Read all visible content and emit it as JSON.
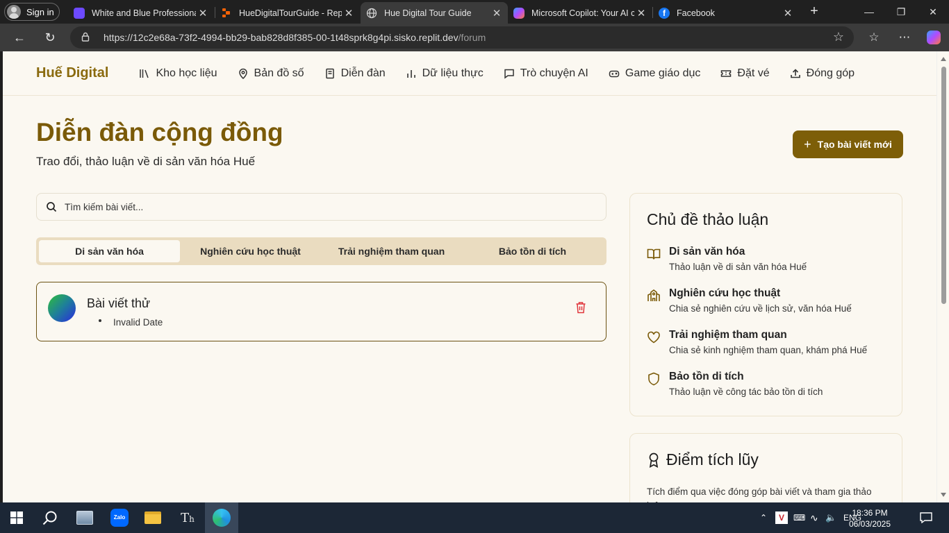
{
  "browser": {
    "signin_label": "Sign in",
    "tabs": [
      {
        "title": "White and Blue Professional",
        "favicon_color": "#6d4aff"
      },
      {
        "title": "HueDigitalTourGuide - Repli",
        "favicon_color": "#f26207"
      },
      {
        "title": "Hue Digital Tour Guide",
        "favicon_color": "#cfcfcf"
      },
      {
        "title": "Microsoft Copilot: Your AI c",
        "favicon_color": "#3aa0ff"
      },
      {
        "title": "Facebook",
        "favicon_color": "#1877f2"
      }
    ],
    "url_main": "https://12c2e68a-73f2-4994-bb29-bab828d8f385-00-1t48sprk8g4pi.sisko.replit.dev",
    "url_path": "/forum"
  },
  "site": {
    "brand": "Huế Digital",
    "nav": [
      {
        "label": "Kho học liệu",
        "icon": "library-icon"
      },
      {
        "label": "Bản đồ số",
        "icon": "map-pin-icon"
      },
      {
        "label": "Diễn đàn",
        "icon": "book-icon"
      },
      {
        "label": "Dữ liệu thực",
        "icon": "bar-chart-icon"
      },
      {
        "label": "Trò chuyện AI",
        "icon": "chat-icon"
      },
      {
        "label": "Game giáo dục",
        "icon": "gamepad-icon"
      },
      {
        "label": "Đặt vé",
        "icon": "ticket-icon"
      },
      {
        "label": "Đóng góp",
        "icon": "upload-icon"
      }
    ]
  },
  "forum": {
    "title": "Diễn đàn cộng đồng",
    "subtitle": "Trao đổi, thảo luận về di sản văn hóa Huế",
    "create_button": "Tạo bài viết mới",
    "search_placeholder": "Tìm kiếm bài viết...",
    "tabs": [
      "Di sản văn hóa",
      "Nghiên cứu học thuật",
      "Trải nghiệm tham quan",
      "Bảo tồn di tích"
    ],
    "active_tab": 0,
    "posts": [
      {
        "title": "Bài viết thử",
        "date": "Invalid Date"
      }
    ]
  },
  "sidebar": {
    "topics_title": "Chủ đề thảo luận",
    "topics": [
      {
        "name": "Di sản văn hóa",
        "desc": "Thảo luận về di sản văn hóa Huế",
        "icon": "open-book-icon"
      },
      {
        "name": "Nghiên cứu học thuật",
        "desc": "Chia sẻ nghiên cứu về lịch sử, văn hóa Huế",
        "icon": "school-icon"
      },
      {
        "name": "Trải nghiệm tham quan",
        "desc": "Chia sẻ kinh nghiệm tham quan, khám phá Huế",
        "icon": "heart-icon"
      },
      {
        "name": "Bảo tồn di tích",
        "desc": "Thảo luận về công tác bảo tồn di tích",
        "icon": "shield-icon"
      }
    ],
    "points_title": "Điểm tích lũy",
    "points_desc": "Tích điểm qua việc đóng góp bài viết và tham gia thảo luận"
  },
  "taskbar": {
    "lang": "ENG",
    "time": "18:36 PM",
    "date": "06/03/2025"
  },
  "colors": {
    "brand": "#8a6a0e",
    "button": "#7d5e08",
    "tabs_bg": "#eadcc0",
    "page_bg": "#fbf8f1",
    "delete": "#e0343a"
  }
}
